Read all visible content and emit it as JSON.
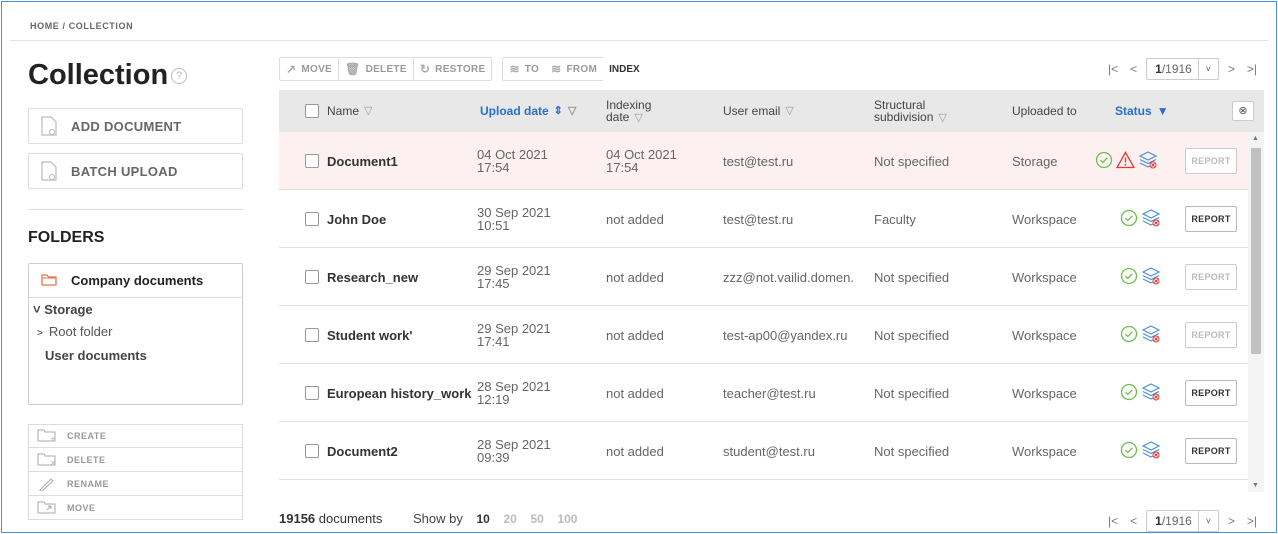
{
  "breadcrumb": "HOME / COLLECTION",
  "page_title": "Collection",
  "help_glyph": "?",
  "sidebar": {
    "add_document": "ADD DOCUMENT",
    "batch_upload": "BATCH UPLOAD",
    "folders_heading": "FOLDERS",
    "company_documents": "Company documents",
    "storage": "Storage",
    "root_folder": "Root folder",
    "user_documents": "User documents",
    "actions": [
      "CREATE",
      "DELETE",
      "RENAME",
      "MOVE"
    ]
  },
  "toolbar": {
    "move": "MOVE",
    "delete": "DELETE",
    "restore": "RESTORE",
    "to": "TO",
    "from": "FROM",
    "index": "INDEX"
  },
  "pager": {
    "current": "1",
    "total": "/1916"
  },
  "columns": {
    "name": "Name",
    "upload_date": "Upload date",
    "indexing_date_1": "Indexing",
    "indexing_date_2": "date",
    "user_email": "User email",
    "structural_1": "Structural",
    "structural_2": "subdivision",
    "uploaded_to": "Uploaded to",
    "status": "Status"
  },
  "rows": [
    {
      "name": "Document1",
      "upload_d": "04 Oct 2021",
      "upload_t": "17:54",
      "index_d": "04 Oct 2021",
      "index_t": "17:54",
      "email": "test@test.ru",
      "subdivision": "Not specified",
      "uploaded_to": "Storage",
      "report": "REPORT",
      "warn": true,
      "report_active": false
    },
    {
      "name": "John Doe",
      "upload_d": "30 Sep 2021",
      "upload_t": "10:51",
      "index_d": "not added",
      "index_t": "",
      "email": "test@test.ru",
      "subdivision": "Faculty",
      "uploaded_to": "Workspace",
      "report": "REPORT",
      "warn": false,
      "report_active": true
    },
    {
      "name": "Research_new",
      "upload_d": "29 Sep 2021",
      "upload_t": "17:45",
      "index_d": "not added",
      "index_t": "",
      "email": "zzz@not.vailid.domen.",
      "subdivision": "Not specified",
      "uploaded_to": "Workspace",
      "report": "REPORT",
      "warn": false,
      "report_active": false
    },
    {
      "name": "Student work'",
      "upload_d": "29 Sep 2021",
      "upload_t": "17:41",
      "index_d": "not added",
      "index_t": "",
      "email": "test-ap00@yandex.ru",
      "subdivision": "Not specified",
      "uploaded_to": "Workspace",
      "report": "REPORT",
      "warn": false,
      "report_active": false
    },
    {
      "name": "European history_work",
      "upload_d": "28 Sep 2021",
      "upload_t": "12:19",
      "index_d": "not added",
      "index_t": "",
      "email": "teacher@test.ru",
      "subdivision": "Not specified",
      "uploaded_to": "Workspace",
      "report": "REPORT",
      "warn": false,
      "report_active": true
    },
    {
      "name": "Document2",
      "upload_d": "28 Sep 2021",
      "upload_t": "09:39",
      "index_d": "not added",
      "index_t": "",
      "email": "student@test.ru",
      "subdivision": "Not specified",
      "uploaded_to": "Workspace",
      "report": "REPORT",
      "warn": false,
      "report_active": true
    }
  ],
  "footer": {
    "count": "19156",
    "count_label": "documents",
    "show_by": "Show by",
    "sizes": [
      "10",
      "20",
      "50",
      "100"
    ]
  },
  "colors": {
    "accent": "#2a6fc9",
    "ok": "#6bbf4a",
    "warn": "#e53935"
  }
}
